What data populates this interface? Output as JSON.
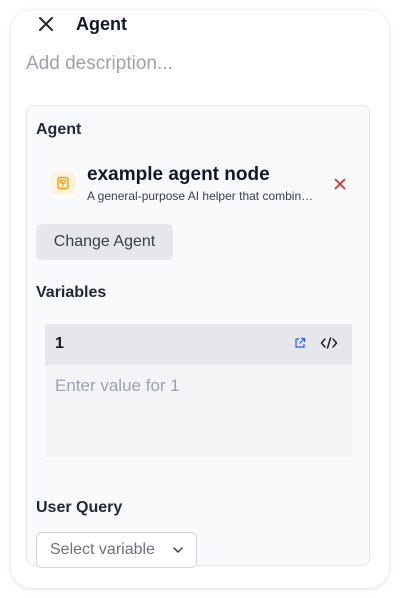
{
  "header": {
    "title": "Agent",
    "description_placeholder": "Add description..."
  },
  "agent_section": {
    "label": "Agent",
    "agent": {
      "name": "example agent node",
      "description": "A general-purpose AI helper that combin…"
    },
    "change_button": "Change Agent"
  },
  "variables_section": {
    "label": "Variables",
    "items": [
      {
        "name": "1",
        "value": "",
        "placeholder": "Enter value for 1"
      }
    ]
  },
  "user_query_section": {
    "label": "User Query",
    "select_placeholder": "Select variable"
  },
  "colors": {
    "remove_icon": "#dc2626",
    "open_icon": "#2563eb",
    "agent_icon": "#f59e0b"
  }
}
